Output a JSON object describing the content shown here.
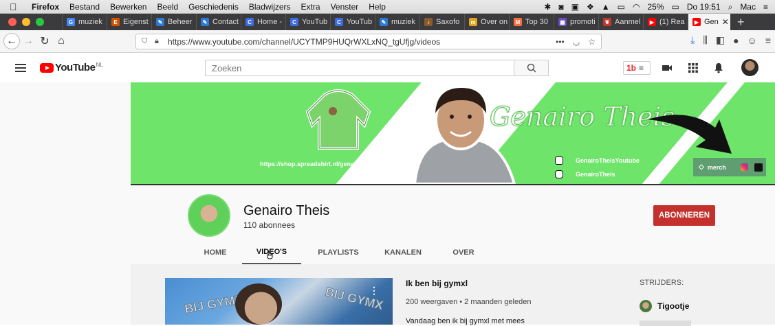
{
  "menubar": {
    "app": "Firefox",
    "items": [
      "Bestand",
      "Bewerken",
      "Beeld",
      "Geschiedenis",
      "Bladwijzers",
      "Extra",
      "Venster",
      "Help"
    ],
    "battery": "25%",
    "clock": "Do 19:51",
    "user": "Mac"
  },
  "tabs": [
    {
      "label": "muziek",
      "color": "#4285f4",
      "glyph": "G"
    },
    {
      "label": "Eigenst",
      "color": "#d35400",
      "glyph": "E"
    },
    {
      "label": "Beheer",
      "color": "#2b7bd6",
      "glyph": "✎"
    },
    {
      "label": "Contact",
      "color": "#2b7bd6",
      "glyph": "✎"
    },
    {
      "label": "Home -",
      "color": "#3c6ee0",
      "glyph": "C"
    },
    {
      "label": "YouTub",
      "color": "#3c6ee0",
      "glyph": "C"
    },
    {
      "label": "YouTub",
      "color": "#3c6ee0",
      "glyph": "C"
    },
    {
      "label": "muziek",
      "color": "#2b7bd6",
      "glyph": "✎"
    },
    {
      "label": "Saxofo",
      "color": "#8a5a2b",
      "glyph": "♪"
    },
    {
      "label": "Over on",
      "color": "#e0a41a",
      "glyph": "m"
    },
    {
      "label": "Top 30",
      "color": "#ff6f3c",
      "glyph": "M"
    },
    {
      "label": "promoti",
      "color": "#6a4bc4",
      "glyph": "▦"
    },
    {
      "label": "Aanmel",
      "color": "#c0392b",
      "glyph": "❦"
    },
    {
      "label": "(1) Rea",
      "color": "#ff0000",
      "glyph": "▶"
    }
  ],
  "active_tab": {
    "label": "Gen",
    "color": "#ff0000",
    "glyph": "▶"
  },
  "navbar": {
    "url": "https://www.youtube.com/channel/UCYTMP9HUQrWXLxNQ_tgUfjg/videos"
  },
  "youtube": {
    "logo_text": "YouTube",
    "country": "NL",
    "search_placeholder": "Zoeken"
  },
  "banner": {
    "title": "Genairo Theis",
    "shop_url": "https://shop.spreadshirt.nl/genairo-theis",
    "tiktok": "GenairoTheisYoutube",
    "instagram": "GenairoTheis",
    "merch": "merch"
  },
  "channel": {
    "name": "Genairo Theis",
    "subscribers": "110 abonnees",
    "subscribe_label": "ABONNEREN",
    "tabs": [
      "HOME",
      "VIDEO'S",
      "PLAYLISTS",
      "KANALEN",
      "OVER"
    ],
    "active_tab_index": 1
  },
  "video": {
    "title": "Ik ben bij gymxl",
    "meta": "200 weergaven • 2 maanden geleden",
    "description": "Vandaag ben ik bij gymxl met mees",
    "thumb_text": "BIJ GYMX"
  },
  "sidebar": {
    "heading": "STRIJDERS:",
    "item": "Tigootje"
  }
}
